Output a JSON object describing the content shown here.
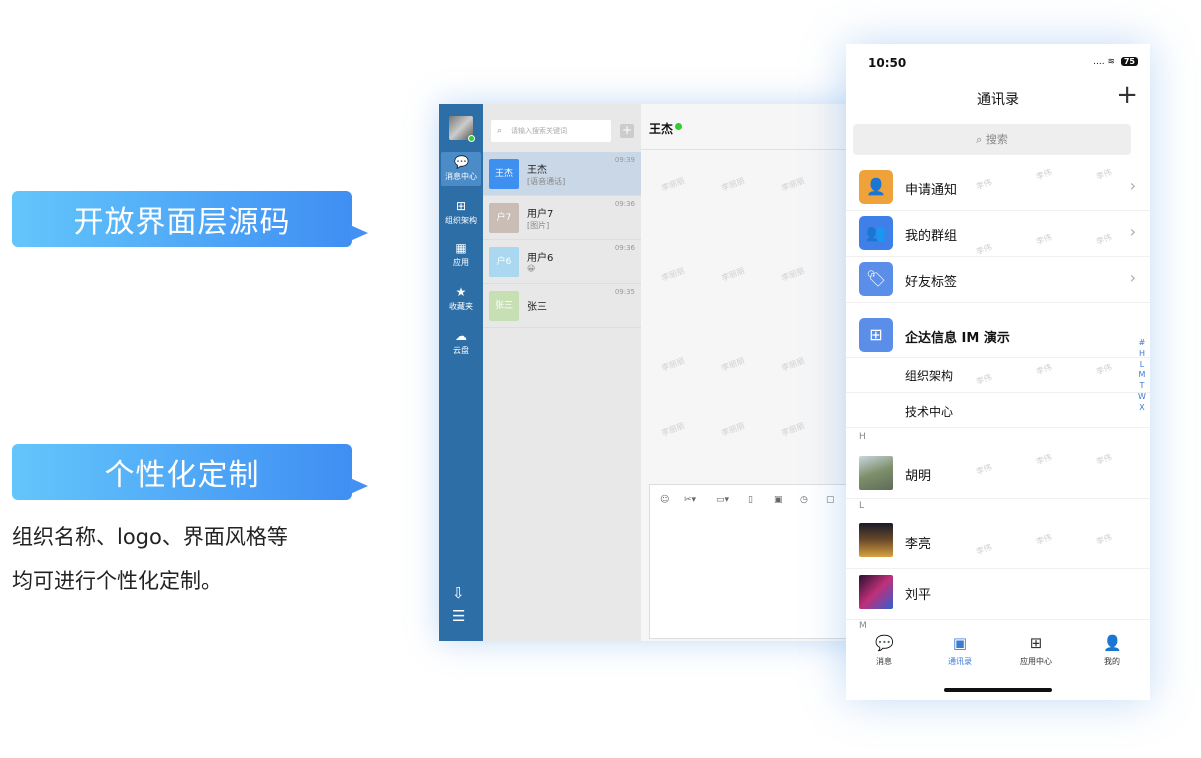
{
  "labels": {
    "open_source": "开放界面层源码",
    "personalize": "个性化定制"
  },
  "description": [
    "组织名称、logo、界面风格等",
    "均可进行个性化定制。"
  ],
  "desktop": {
    "sidebar": [
      {
        "label": "消息中心",
        "icon": "chat-icon",
        "active": true
      },
      {
        "label": "组织架构",
        "icon": "org-icon",
        "active": false
      },
      {
        "label": "应用",
        "icon": "apps-icon",
        "active": false
      },
      {
        "label": "收藏夹",
        "icon": "star-icon",
        "active": false
      },
      {
        "label": "云盘",
        "icon": "cloud-icon",
        "active": false
      }
    ],
    "search_placeholder": "请输入搜索关键词",
    "conversations": [
      {
        "name": "王杰",
        "avatar_text": "王杰",
        "sub": "[语音通话]",
        "time": "09:39",
        "avatar_color": "#3d8ff0"
      },
      {
        "name": "用户7",
        "avatar_text": "户7",
        "sub": "[图片]",
        "time": "09:36",
        "avatar_color": "#c9bdb5"
      },
      {
        "name": "用户6",
        "avatar_text": "户6",
        "sub": "😀",
        "time": "09:36",
        "avatar_color": "#a9d8f0"
      },
      {
        "name": "张三",
        "avatar_text": "张三",
        "sub": "",
        "time": "09:35",
        "avatar_color": "#c6e0b4"
      }
    ],
    "chat_title": "王杰",
    "watermark": "李丽丽"
  },
  "phone": {
    "time": "10:50",
    "battery": "75",
    "title": "通讯录",
    "add_icon": "plus-icon",
    "search_placeholder": "搜索",
    "rows": [
      {
        "label": "申请通知",
        "icon": "user-plus-icon",
        "color": "#f0a23a",
        "chevron": true
      },
      {
        "label": "我的群组",
        "icon": "group-icon",
        "color": "#3f7fe8",
        "chevron": true
      },
      {
        "label": "好友标签",
        "icon": "tag-icon",
        "color": "#5b8ee8",
        "chevron": true
      },
      {
        "label": "企达信息 IM 演示",
        "icon": "org-icon",
        "color": "#5b8ee8",
        "chevron": false
      }
    ],
    "sub_rows": [
      "组织架构",
      "技术中心"
    ],
    "sections": [
      "H",
      "L",
      "M"
    ],
    "contacts": [
      "胡明",
      "李亮",
      "刘平"
    ],
    "index": [
      "#",
      "H",
      "L",
      "M",
      "T",
      "W",
      "X"
    ],
    "tabs": [
      {
        "label": "消息",
        "icon": "chat-icon",
        "active": false
      },
      {
        "label": "通讯录",
        "icon": "contacts-icon",
        "active": true
      },
      {
        "label": "应用中心",
        "icon": "apps-icon",
        "active": false
      },
      {
        "label": "我的",
        "icon": "person-icon",
        "active": false
      }
    ],
    "watermark": "李伟"
  }
}
